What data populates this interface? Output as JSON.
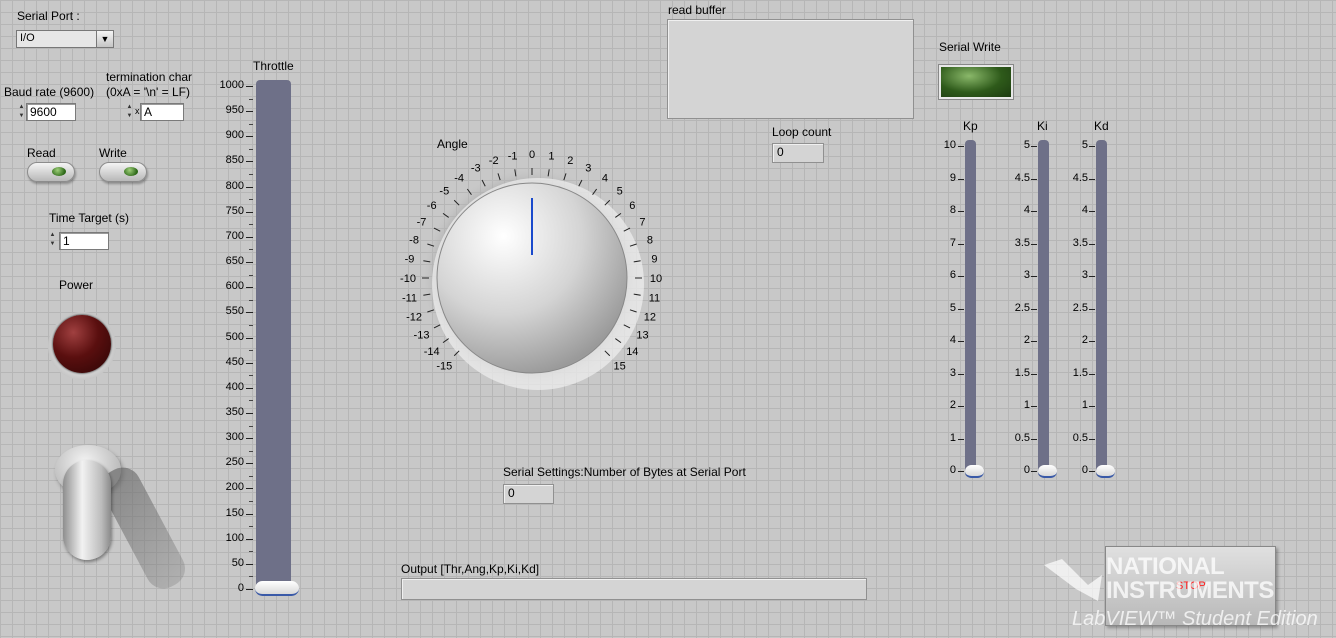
{
  "serial_port": {
    "label": "Serial Port :",
    "value": "I/O"
  },
  "baud": {
    "label": "Baud rate (9600)",
    "value": "9600"
  },
  "termination": {
    "label_line1": "termination char",
    "label_line2": "(0xA = '\\n' = LF)",
    "prefix": "x",
    "value": "A"
  },
  "read_switch": {
    "label": "Read"
  },
  "write_switch": {
    "label": "Write"
  },
  "time_target": {
    "label": "Time Target (s)",
    "value": "1"
  },
  "power": {
    "label": "Power",
    "led_color": "#5a0f0f"
  },
  "throttle": {
    "label": "Throttle",
    "ticks": [
      "1000",
      "950",
      "900",
      "850",
      "800",
      "750",
      "700",
      "650",
      "600",
      "550",
      "500",
      "450",
      "400",
      "350",
      "300",
      "250",
      "200",
      "150",
      "100",
      "50",
      "0"
    ],
    "value": 0
  },
  "angle": {
    "label": "Angle",
    "ticks": [
      "-15",
      "-14",
      "-13",
      "-12",
      "-11",
      "-10",
      "-9",
      "-8",
      "-7",
      "-6",
      "-5",
      "-4",
      "-3",
      "-2",
      "-1",
      "0",
      "1",
      "2",
      "3",
      "4",
      "5",
      "6",
      "7",
      "8",
      "9",
      "10",
      "11",
      "12",
      "13",
      "14",
      "15"
    ],
    "value": 0
  },
  "read_buffer": {
    "label": "read buffer",
    "value": ""
  },
  "serial_write": {
    "label": "Serial Write",
    "led_color": "#2e5a1a"
  },
  "loop_count": {
    "label": "Loop count",
    "value": "0"
  },
  "bytes_at_port": {
    "label": "Serial Settings:Number of Bytes at Serial Port",
    "value": "0"
  },
  "output": {
    "label": "Output [Thr,Ang,Kp,Ki,Kd]",
    "value": ""
  },
  "kp": {
    "label": "Kp",
    "ticks": [
      "10",
      "9",
      "8",
      "7",
      "6",
      "5",
      "4",
      "3",
      "2",
      "1",
      "0"
    ],
    "value": 0
  },
  "ki": {
    "label": "Ki",
    "ticks": [
      "5",
      "4.5",
      "4",
      "3.5",
      "3",
      "2.5",
      "2",
      "1.5",
      "1",
      "0.5",
      "0"
    ],
    "value": 0
  },
  "kd": {
    "label": "Kd",
    "ticks": [
      "5",
      "4.5",
      "4",
      "3.5",
      "3",
      "2.5",
      "2",
      "1.5",
      "1",
      "0.5",
      "0"
    ],
    "value": 0
  },
  "stop_button": {
    "label": "STOP",
    "color": "#ff2020"
  },
  "watermark": {
    "line1": "NATIONAL",
    "line2": "INSTRUMENTS",
    "line3": "LabVIEW™ Student Edition"
  },
  "colors": {
    "slider_track": "#6e7088",
    "panel_bg": "#c8c8c8"
  }
}
